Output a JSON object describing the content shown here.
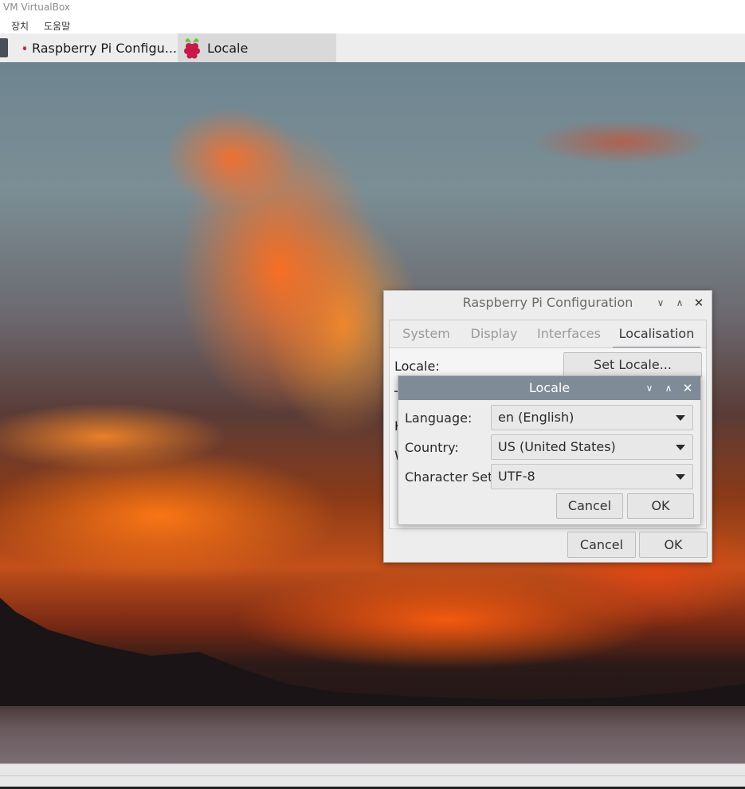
{
  "host": {
    "title": "VM VirtualBox",
    "menu": [
      "장치",
      "도움말"
    ]
  },
  "taskbar": {
    "tasks": [
      {
        "label": "Raspberry Pi Configu...",
        "icon": "raspberry-icon",
        "active": false
      },
      {
        "label": "Locale",
        "icon": "raspberry-icon",
        "active": true
      }
    ]
  },
  "config_window": {
    "title": "Raspberry Pi Configuration",
    "tabs": [
      "System",
      "Display",
      "Interfaces",
      "Localisation"
    ],
    "active_tab": "Localisation",
    "rows": [
      {
        "label": "Locale:",
        "button": "Set Locale..."
      },
      {
        "label": "T"
      },
      {
        "label": "K"
      },
      {
        "label": "W"
      }
    ],
    "cancel_label": "Cancel",
    "ok_label": "OK"
  },
  "locale_dialog": {
    "title": "Locale",
    "fields": [
      {
        "label": "Language:",
        "value": "en (English)"
      },
      {
        "label": "Country:",
        "value": "US (United States)"
      },
      {
        "label": "Character Set:",
        "value": "UTF-8"
      }
    ],
    "cancel_label": "Cancel",
    "ok_label": "OK"
  },
  "colors": {
    "locale_titlebar": "#7f8b96",
    "window_bg": "#ededed"
  }
}
